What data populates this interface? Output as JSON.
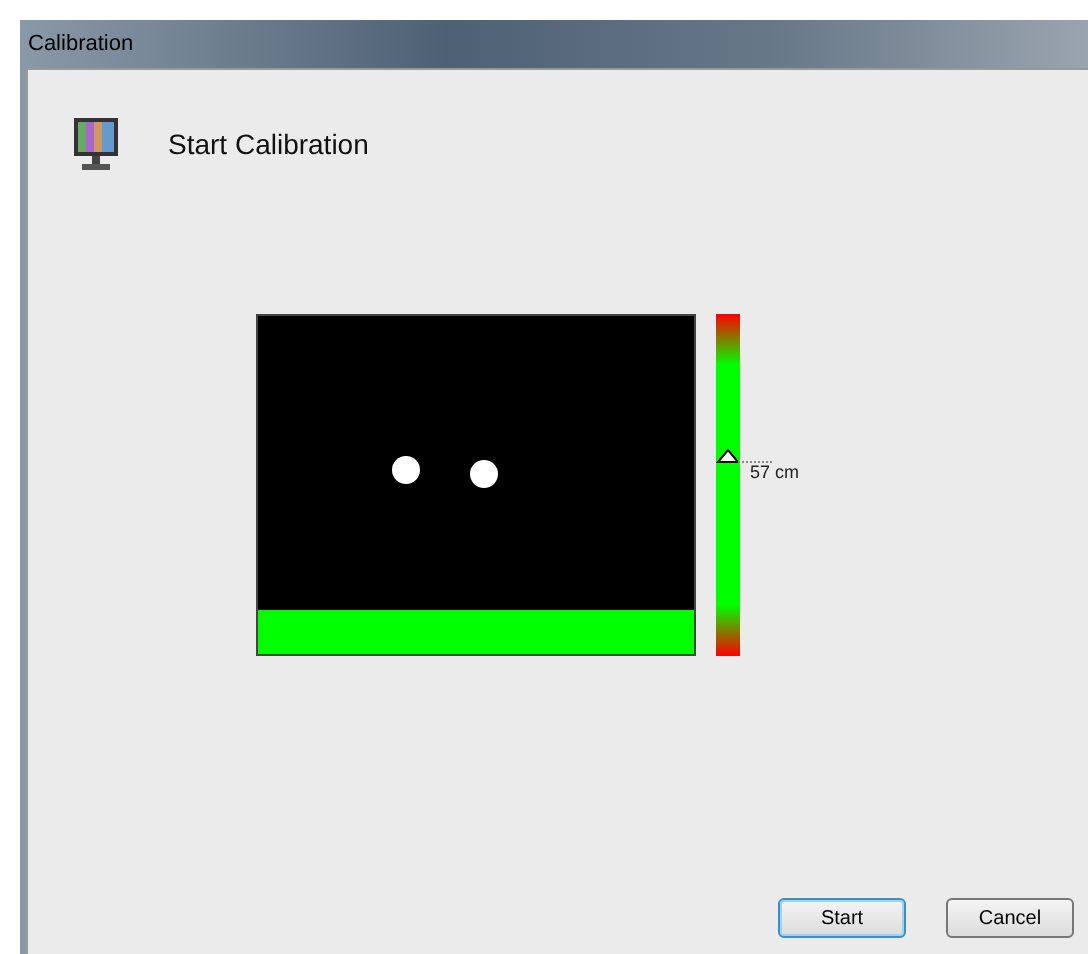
{
  "window": {
    "title": "Calibration"
  },
  "header": {
    "title": "Start Calibration"
  },
  "distance": {
    "level": 0.6,
    "reading": "57 cm"
  },
  "buttons": [
    {
      "label": "Start",
      "selected": true
    },
    {
      "label": "Cancel",
      "selected": false
    }
  ]
}
